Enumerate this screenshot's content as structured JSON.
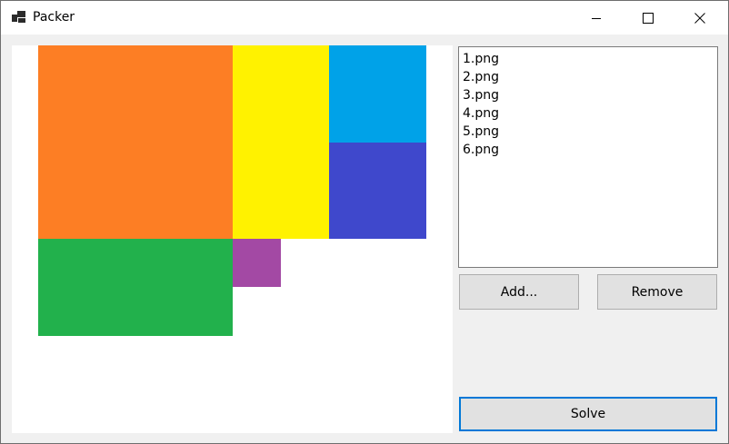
{
  "window": {
    "title": "Packer",
    "controls": [
      "minimize-icon",
      "maximize-icon",
      "close-icon"
    ]
  },
  "canvas": {
    "rects": [
      {
        "name": "packed-rect-orange",
        "color": "#fd7e24"
      },
      {
        "name": "packed-rect-yellow",
        "color": "#fff200"
      },
      {
        "name": "packed-rect-blue",
        "color": "#00a2e8"
      },
      {
        "name": "packed-rect-indigo",
        "color": "#3f48cc"
      },
      {
        "name": "packed-rect-green",
        "color": "#22b14c"
      },
      {
        "name": "packed-rect-purple",
        "color": "#a349a4"
      }
    ]
  },
  "files": {
    "items": [
      "1.png",
      "2.png",
      "3.png",
      "4.png",
      "5.png",
      "6.png"
    ]
  },
  "buttons": {
    "add_label": "Add...",
    "remove_label": "Remove",
    "solve_label": "Solve"
  }
}
